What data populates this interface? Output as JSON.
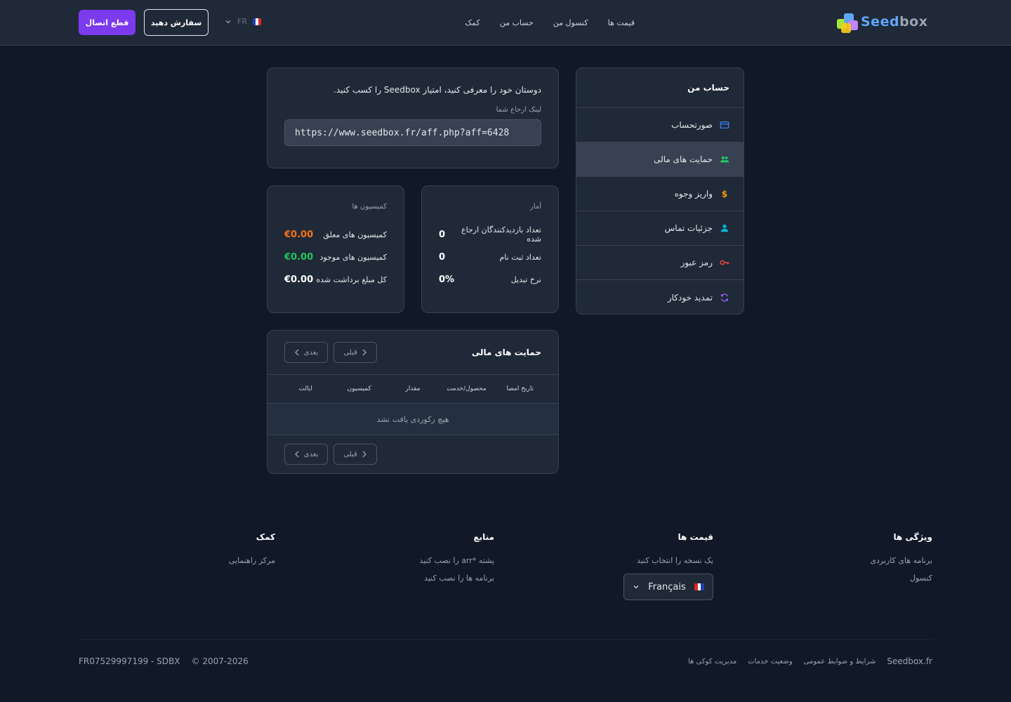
{
  "header": {
    "logo_text_a": "Seed",
    "logo_text_b": "box",
    "nav": [
      "قیمت ها",
      "کنسول من",
      "حساب من",
      "کمک"
    ],
    "lang_code": "FR",
    "order_button": "سفارش دهید",
    "logout_button": "قطع اتصال"
  },
  "sidebar": {
    "title": "حساب من",
    "items": [
      {
        "label": "صورتحساب",
        "icon": "credit-card-icon",
        "color": "#3b82f6"
      },
      {
        "label": "حمایت های مالی",
        "icon": "users-icon",
        "color": "#22c55e"
      },
      {
        "label": "واریز وجوه",
        "icon": "dollar-icon",
        "color": "#f59e0b"
      },
      {
        "label": "جزئیات تماس",
        "icon": "user-icon",
        "color": "#06b6d4"
      },
      {
        "label": "رمز عبور",
        "icon": "key-icon",
        "color": "#ef4444"
      },
      {
        "label": "تمدید خودکار",
        "icon": "refresh-icon",
        "color": "#8b5cf6"
      }
    ]
  },
  "referral": {
    "intro": "دوستان خود را معرفی کنید، امتیاز Seedbox را کسب کنید.",
    "label": "لینک ارجاع شما",
    "link": "https://www.seedbox.fr/aff.php?aff=6428"
  },
  "stats": {
    "title": "آمار",
    "rows": [
      {
        "label": "تعداد بازدیدکنندگان ارجاع شده",
        "value": "0"
      },
      {
        "label": "تعداد ثبت نام",
        "value": "0"
      },
      {
        "label": "نرخ تبدیل",
        "value": "0%"
      }
    ]
  },
  "commissions": {
    "title": "کمیسیون ها",
    "rows": [
      {
        "label": "کمیسیون های معلق",
        "value": "€0.00"
      },
      {
        "label": "کمیسیون های موجود",
        "value": "€0.00"
      },
      {
        "label": "کل مبلغ برداشت شده",
        "value": "€0.00"
      }
    ]
  },
  "affiliates": {
    "title": "حمایت های مالی",
    "prev": "قبلی",
    "next": "بعدی",
    "columns": [
      "تاریخ امضا",
      "محصول/خدمت",
      "مقدار",
      "کمیسیون",
      "ایالت"
    ],
    "empty": "هیچ رکوردی یافت نشد"
  },
  "footer": {
    "columns": [
      {
        "title": "ویژگی ها",
        "links": [
          "برنامه های کاربردی",
          "کنسول"
        ]
      },
      {
        "title": "قیمت ها",
        "links": [
          "یک نسخه را انتخاب کنید"
        ]
      },
      {
        "title": "منابع",
        "links": [
          "پشته *arr را نصب کنید",
          "برنامه ها را نصب کنید"
        ]
      },
      {
        "title": "کمک",
        "links": [
          "مرکز راهنمایی"
        ]
      }
    ],
    "language": "Français",
    "brand": "Seedbox.fr",
    "legal_links": [
      "شرایط و ضوابط عمومی",
      "وضعیت خدمات",
      "مدیریت کوکی ها"
    ],
    "copyright": "© 2007-2026",
    "company": "FR07529997199 - SDBX"
  }
}
